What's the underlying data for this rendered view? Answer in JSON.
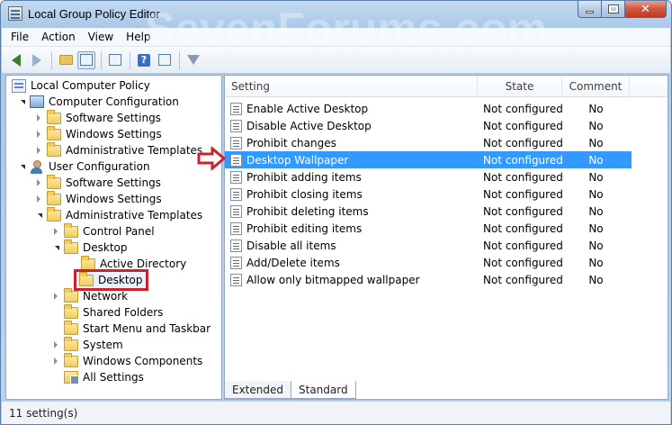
{
  "window": {
    "title": "Local Group Policy Editor",
    "watermark": "SevenForums.com"
  },
  "menu": {
    "file": "File",
    "action": "Action",
    "view": "View",
    "help": "Help"
  },
  "tree": {
    "root": "Local Computer Policy",
    "computer_configuration": "Computer Configuration",
    "cc_software_settings": "Software Settings",
    "cc_windows_settings": "Windows Settings",
    "cc_admin_templates": "Administrative Templates",
    "user_configuration": "User Configuration",
    "uc_software_settings": "Software Settings",
    "uc_windows_settings": "Windows Settings",
    "uc_admin_templates": "Administrative Templates",
    "control_panel": "Control Panel",
    "desktop": "Desktop",
    "active_directory": "Active Directory",
    "desktop_child": "Desktop",
    "network": "Network",
    "shared_folders": "Shared Folders",
    "start_menu": "Start Menu and Taskbar",
    "system": "System",
    "windows_components": "Windows Components",
    "all_settings": "All Settings"
  },
  "list": {
    "headers": {
      "setting": "Setting",
      "state": "State",
      "comment": "Comment"
    },
    "rows": [
      {
        "setting": "Enable Active Desktop",
        "state": "Not configured",
        "comment": "No"
      },
      {
        "setting": "Disable Active Desktop",
        "state": "Not configured",
        "comment": "No"
      },
      {
        "setting": "Prohibit changes",
        "state": "Not configured",
        "comment": "No"
      },
      {
        "setting": "Desktop Wallpaper",
        "state": "Not configured",
        "comment": "No"
      },
      {
        "setting": "Prohibit adding items",
        "state": "Not configured",
        "comment": "No"
      },
      {
        "setting": "Prohibit closing items",
        "state": "Not configured",
        "comment": "No"
      },
      {
        "setting": "Prohibit deleting items",
        "state": "Not configured",
        "comment": "No"
      },
      {
        "setting": "Prohibit editing items",
        "state": "Not configured",
        "comment": "No"
      },
      {
        "setting": "Disable all items",
        "state": "Not configured",
        "comment": "No"
      },
      {
        "setting": "Add/Delete items",
        "state": "Not configured",
        "comment": "No"
      },
      {
        "setting": "Allow only bitmapped wallpaper",
        "state": "Not configured",
        "comment": "No"
      }
    ],
    "selected_setting": "Desktop Wallpaper"
  },
  "tabs": {
    "extended": "Extended",
    "standard": "Standard"
  },
  "status": {
    "text": "11 setting(s)"
  },
  "colors": {
    "selection": "#3399ff",
    "annotation_red": "#d0202a"
  }
}
